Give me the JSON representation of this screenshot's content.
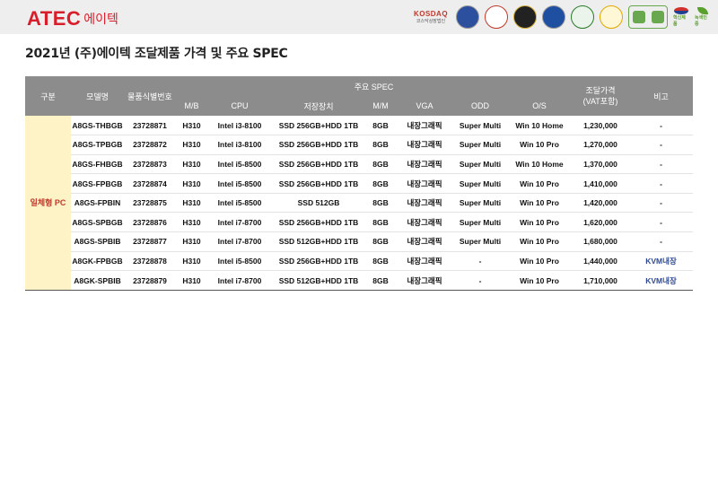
{
  "header": {
    "logo_latin": "ATEC",
    "logo_korean": "에이텍",
    "kosdaq_label": "KOSDAQ",
    "kosdaq_sub": "코스닥상장법인",
    "badge_leaf_label": "녹색인증",
    "badge_gov_label": "혁신제품"
  },
  "title": "2021년 (주)에이텍 조달제품 가격 및 주요 SPEC",
  "table": {
    "headers": {
      "category": "구분",
      "model": "모델명",
      "item_no": "물품식별번호",
      "spec_group": "주요 SPEC",
      "mb": "M/B",
      "cpu": "CPU",
      "storage": "저장장치",
      "mem": "M/M",
      "vga": "VGA",
      "odd": "ODD",
      "os": "O/S",
      "price": "조달가격\n(VAT포함)",
      "note": "비고"
    },
    "category_label": "일체형 PC",
    "rows": [
      {
        "model": "A8GS-THBGB",
        "item_no": "23728871",
        "mb": "H310",
        "cpu": "Intel i3-8100",
        "storage": "SSD 256GB+HDD 1TB",
        "mem": "8GB",
        "vga": "내장그래픽",
        "odd": "Super Multi",
        "os": "Win 10 Home",
        "price": "1,230,000",
        "note": "-"
      },
      {
        "model": "A8GS-TPBGB",
        "item_no": "23728872",
        "mb": "H310",
        "cpu": "Intel i3-8100",
        "storage": "SSD 256GB+HDD 1TB",
        "mem": "8GB",
        "vga": "내장그래픽",
        "odd": "Super Multi",
        "os": "Win 10 Pro",
        "price": "1,270,000",
        "note": "-"
      },
      {
        "model": "A8GS-FHBGB",
        "item_no": "23728873",
        "mb": "H310",
        "cpu": "Intel i5-8500",
        "storage": "SSD 256GB+HDD 1TB",
        "mem": "8GB",
        "vga": "내장그래픽",
        "odd": "Super Multi",
        "os": "Win 10 Home",
        "price": "1,370,000",
        "note": "-"
      },
      {
        "model": "A8GS-FPBGB",
        "item_no": "23728874",
        "mb": "H310",
        "cpu": "Intel i5-8500",
        "storage": "SSD 256GB+HDD 1TB",
        "mem": "8GB",
        "vga": "내장그래픽",
        "odd": "Super Multi",
        "os": "Win 10 Pro",
        "price": "1,410,000",
        "note": "-"
      },
      {
        "model": "A8GS-FPBIN",
        "item_no": "23728875",
        "mb": "H310",
        "cpu": "Intel i5-8500",
        "storage": "SSD 512GB",
        "mem": "8GB",
        "vga": "내장그래픽",
        "odd": "Super Multi",
        "os": "Win 10 Pro",
        "price": "1,420,000",
        "note": "-"
      },
      {
        "model": "A8GS-SPBGB",
        "item_no": "23728876",
        "mb": "H310",
        "cpu": "Intel i7-8700",
        "storage": "SSD 256GB+HDD 1TB",
        "mem": "8GB",
        "vga": "내장그래픽",
        "odd": "Super Multi",
        "os": "Win 10 Pro",
        "price": "1,620,000",
        "note": "-"
      },
      {
        "model": "A8GS-SPBIB",
        "item_no": "23728877",
        "mb": "H310",
        "cpu": "Intel i7-8700",
        "storage": "SSD 512GB+HDD 1TB",
        "mem": "8GB",
        "vga": "내장그래픽",
        "odd": "Super Multi",
        "os": "Win 10 Pro",
        "price": "1,680,000",
        "note": "-"
      },
      {
        "model": "A8GK-FPBGB",
        "item_no": "23728878",
        "mb": "H310",
        "cpu": "Intel i5-8500",
        "storage": "SSD 256GB+HDD 1TB",
        "mem": "8GB",
        "vga": "내장그래픽",
        "odd": "-",
        "os": "Win 10 Pro",
        "price": "1,440,000",
        "note": "KVM내장"
      },
      {
        "model": "A8GK-SPBIB",
        "item_no": "23728879",
        "mb": "H310",
        "cpu": "Intel i7-8700",
        "storage": "SSD 512GB+HDD 1TB",
        "mem": "8GB",
        "vga": "내장그래픽",
        "odd": "-",
        "os": "Win 10 Pro",
        "price": "1,710,000",
        "note": "KVM내장"
      }
    ]
  },
  "colors": {
    "brand_red": "#d81e2b",
    "header_gray": "#8c8c8c",
    "category_bg": "#fdf3c6",
    "kvm_blue": "#2f4a8f"
  }
}
